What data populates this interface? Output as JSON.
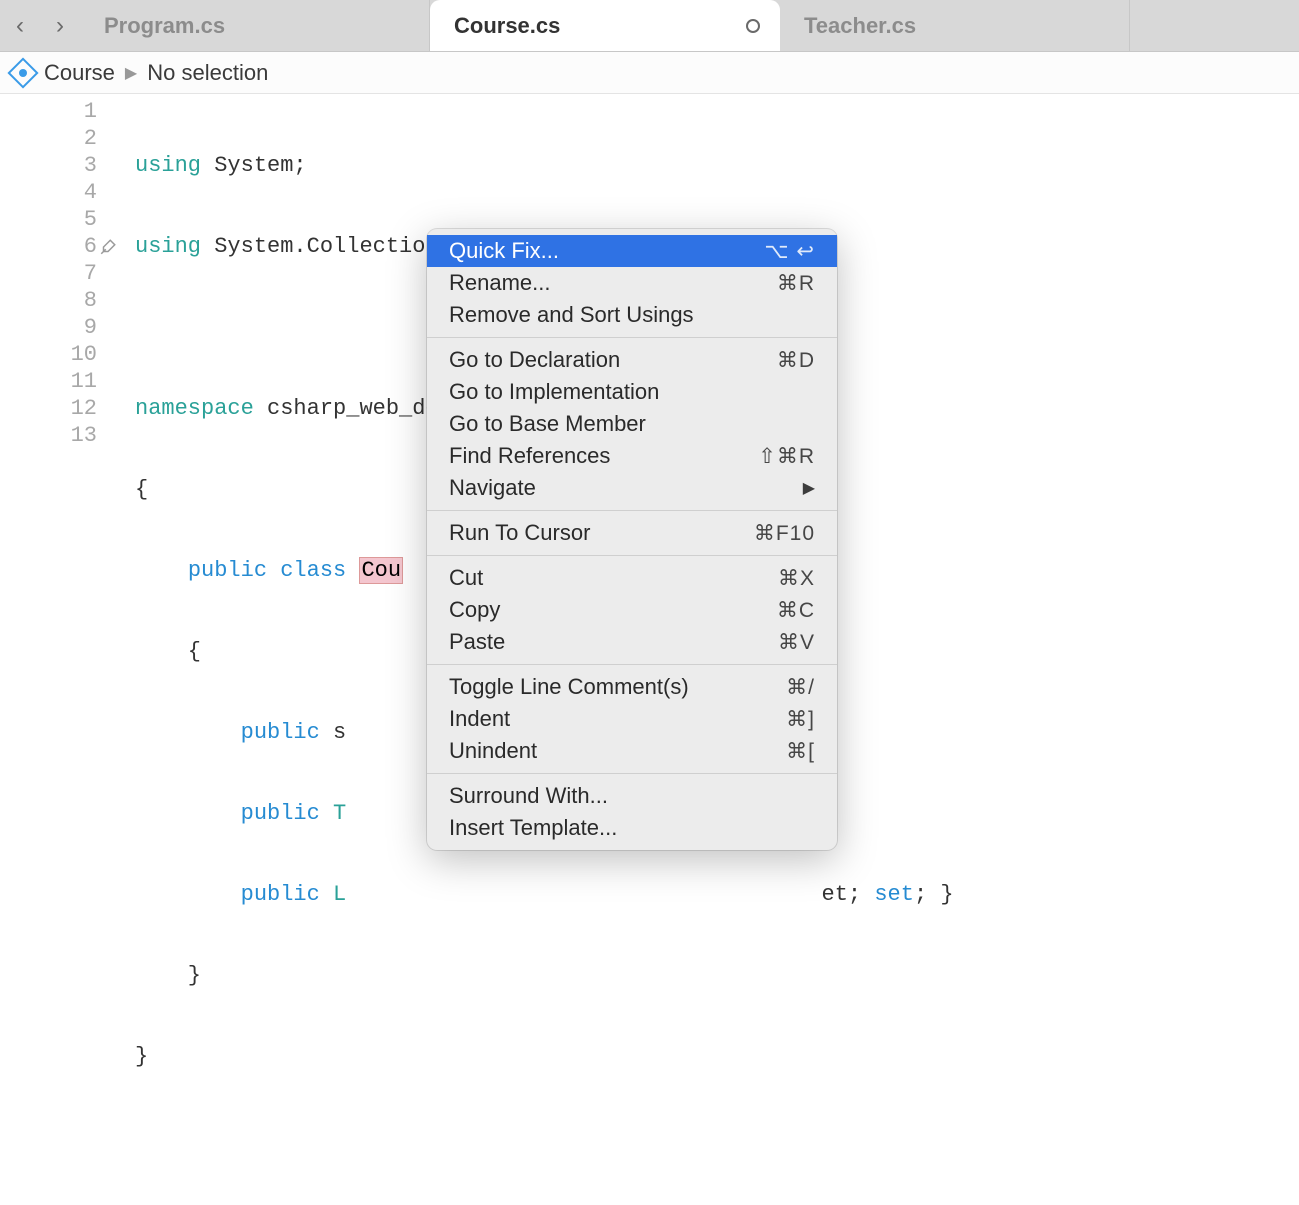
{
  "tabs": {
    "back_arrow": "‹",
    "forward_arrow": "›",
    "items": [
      {
        "label": "Program.cs",
        "active": false
      },
      {
        "label": "Course.cs",
        "active": true
      },
      {
        "label": "Teacher.cs",
        "active": false
      }
    ]
  },
  "breadcrumb": {
    "item1": "Course",
    "item2": "No selection"
  },
  "gutter": {
    "lines": [
      "1",
      "2",
      "3",
      "4",
      "5",
      "6",
      "7",
      "8",
      "9",
      "10",
      "11",
      "12",
      "13"
    ]
  },
  "code": {
    "l1a": "using",
    "l1b": " System;",
    "l2a": "using",
    "l2b": " System.Collections.Generic;",
    "l4a": "namespace",
    "l4b": " csharp_web_dev_lsn4_demo",
    "l5": "{",
    "l6a": "    ",
    "l6b": "public",
    "l6c": " ",
    "l6d": "class",
    "l6e": " ",
    "l6f": "Cou",
    "l7": "    {",
    "l8a": "        ",
    "l8b": "public",
    "l8c": " s",
    "l9a": "        ",
    "l9b": "public",
    "l9c": " T",
    "l10a": "        ",
    "l10b": "public",
    "l10c": " L",
    "l10suffix_a": "et; ",
    "l10suffix_b": "set",
    "l10suffix_c": "; }",
    "l11": "    }",
    "l12": "}"
  },
  "menu": {
    "groups": [
      [
        {
          "label": "Quick Fix...",
          "shortcut": "⌥ ↩",
          "selected": true
        },
        {
          "label": "Rename...",
          "shortcut": "⌘R"
        },
        {
          "label": "Remove and Sort Usings",
          "shortcut": ""
        }
      ],
      [
        {
          "label": "Go to Declaration",
          "shortcut": "⌘D"
        },
        {
          "label": "Go to Implementation",
          "shortcut": ""
        },
        {
          "label": "Go to Base Member",
          "shortcut": ""
        },
        {
          "label": "Find References",
          "shortcut": "⇧⌘R"
        },
        {
          "label": "Navigate",
          "shortcut": "▶",
          "submenu": true
        }
      ],
      [
        {
          "label": "Run To Cursor",
          "shortcut": "⌘F10"
        }
      ],
      [
        {
          "label": "Cut",
          "shortcut": "⌘X"
        },
        {
          "label": "Copy",
          "shortcut": "⌘C"
        },
        {
          "label": "Paste",
          "shortcut": "⌘V"
        }
      ],
      [
        {
          "label": "Toggle Line Comment(s)",
          "shortcut": "⌘/"
        },
        {
          "label": "Indent",
          "shortcut": "⌘]"
        },
        {
          "label": "Unindent",
          "shortcut": "⌘["
        }
      ],
      [
        {
          "label": "Surround With...",
          "shortcut": ""
        },
        {
          "label": "Insert Template...",
          "shortcut": ""
        }
      ]
    ]
  }
}
